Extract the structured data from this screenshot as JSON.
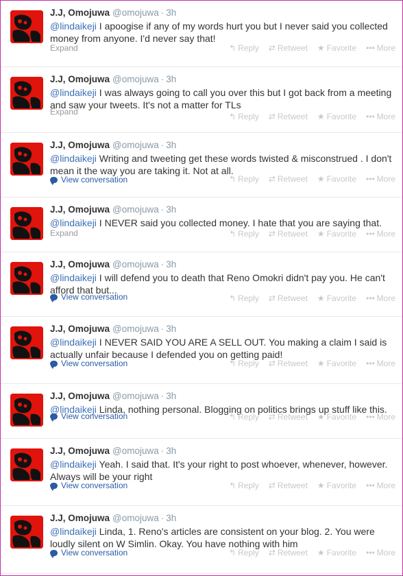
{
  "actions": {
    "reply": "Reply",
    "retweet": "Retweet",
    "favorite": "Favorite",
    "more": "More"
  },
  "icons": {
    "reply": "reply-arrow-icon",
    "retweet": "retweet-arrows-icon",
    "favorite": "star-icon",
    "more": "ellipsis-icon",
    "conversation": "speech-bubble-icon"
  },
  "colors": {
    "border": "#c22ea6",
    "mention": "#3b6fb5",
    "avatar_bg": "#e0140c"
  },
  "tweets": [
    {
      "name": "J.J, Omojuwa",
      "handle": "@omojuwa",
      "time": "3h",
      "mention": "@lindaikeji",
      "text": " I apoogise if any of my words hurt you but I never said you collected money from anyone. I'd never say that!",
      "footer": "Expand"
    },
    {
      "name": "J.J, Omojuwa",
      "handle": "@omojuwa",
      "time": "3h",
      "mention": "@lindaikeji",
      "text": " I was always going to call you over this but I got back from a meeting and saw your tweets. It's not a matter for TLs",
      "footer": "Expand"
    },
    {
      "name": "J.J, Omojuwa",
      "handle": "@omojuwa",
      "time": "3h",
      "mention": "@lindaikeji",
      "text": " Writing and tweeting get these words twisted & misconstrued . I don't mean it the way you are taking it. Not at all.",
      "footer": "View conversation"
    },
    {
      "name": "J.J, Omojuwa",
      "handle": "@omojuwa",
      "time": "3h",
      "mention": "@lindaikeji",
      "text": " I NEVER said you collected money. I hate that you are saying that.",
      "footer": "Expand"
    },
    {
      "name": "J.J, Omojuwa",
      "handle": "@omojuwa",
      "time": "3h",
      "mention": "@lindaikeji",
      "text": " I will defend you to death that Reno Omokri didn't pay you. He can't afford that but...",
      "footer": "View conversation"
    },
    {
      "name": "J.J, Omojuwa",
      "handle": "@omojuwa",
      "time": "3h",
      "mention": "@lindaikeji",
      "text": " I NEVER SAID YOU ARE A SELL OUT. You making a claim I said is actually unfair because I defended you on getting paid!",
      "footer": "View conversation"
    },
    {
      "name": "J.J, Omojuwa",
      "handle": "@omojuwa",
      "time": "3h",
      "mention": "@lindaikeji",
      "text": " Linda, nothing personal. Blogging on politics brings up stuff like this.",
      "footer": "View conversation"
    },
    {
      "name": "J.J, Omojuwa",
      "handle": "@omojuwa",
      "time": "3h",
      "mention": "@lindaikeji",
      "text": " Yeah. I said that. It's your right to post whoever, whenever, however. Always will be your right",
      "footer": "View conversation"
    },
    {
      "name": "J.J, Omojuwa",
      "handle": "@omojuwa",
      "time": "3h",
      "mention": "@lindaikeji",
      "text": " Linda, 1. Reno's articles are consistent on your blog. 2. You were loudly silent on W Simlin. Okay. You have nothing with him",
      "footer": "View conversation"
    }
  ]
}
